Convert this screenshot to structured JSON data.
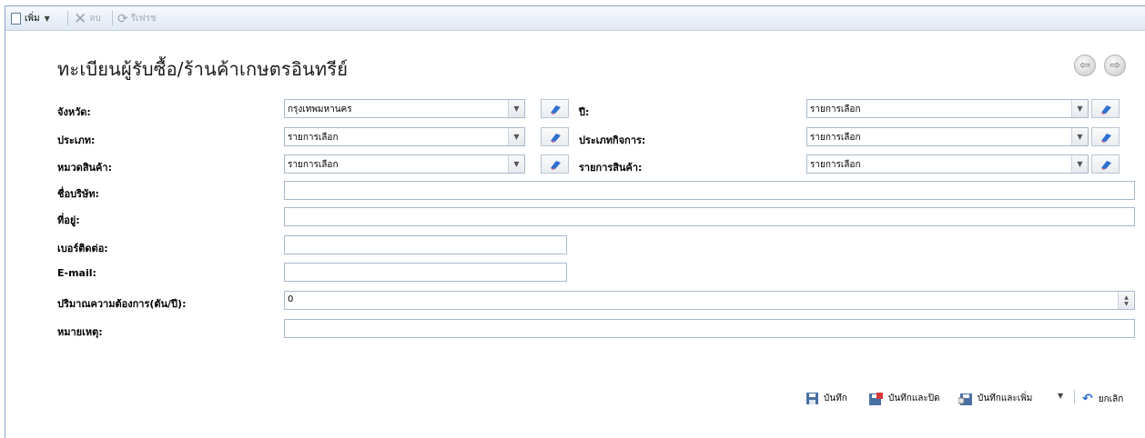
{
  "toolbar": {
    "add_label": "เพิ่ม",
    "delete_label": "ลบ",
    "refresh_label": "รีเฟรช"
  },
  "page": {
    "title": "ทะเบียนผู้รับซื้อ/ร้านค้าเกษตรอินทรีย์"
  },
  "form": {
    "province": {
      "label": "จังหวัด:",
      "value": "กรุงเทพมหานคร"
    },
    "year": {
      "label": "ปี:",
      "value": "รายการเลือก"
    },
    "type": {
      "label": "ประเภท:",
      "value": "รายการเลือก"
    },
    "business_type": {
      "label": "ประเภทกิจการ:",
      "value": "รายการเลือก"
    },
    "category": {
      "label": "หมวดสินค้า:",
      "value": "รายการเลือก"
    },
    "product": {
      "label": "รายการสินค้า:",
      "value": "รายการเลือก"
    },
    "company": {
      "label": "ชื่อบริษัท:",
      "value": ""
    },
    "address": {
      "label": "ที่อยู่:",
      "value": ""
    },
    "phone": {
      "label": "เบอร์ติดต่อ:",
      "value": ""
    },
    "email": {
      "label": "E-mail:",
      "value": ""
    },
    "demand": {
      "label": "ปริมาณความต้องการ(ตัน/ปี):",
      "value": "0"
    },
    "remark": {
      "label": "หมายเหตุ:",
      "value": ""
    }
  },
  "actions": {
    "save": "บันทึก",
    "save_close": "บันทึกและปิด",
    "save_add": "บันทึกและเพิ่ม",
    "cancel": "ยกเลิก"
  }
}
